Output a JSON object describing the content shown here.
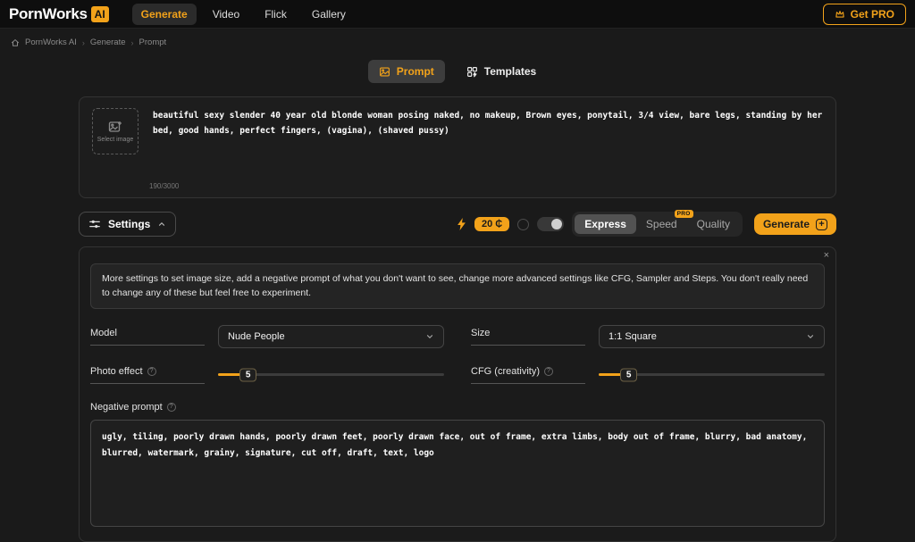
{
  "header": {
    "logo_text": "PornWorks",
    "logo_badge": "AI",
    "nav": [
      {
        "label": "Generate"
      },
      {
        "label": "Video"
      },
      {
        "label": "Flick"
      },
      {
        "label": "Gallery"
      }
    ],
    "get_pro_label": "Get PRO"
  },
  "breadcrumb": {
    "items": [
      {
        "label": "PornWorks AI"
      },
      {
        "label": "Generate"
      },
      {
        "label": "Prompt"
      }
    ]
  },
  "tabs": {
    "prompt_label": "Prompt",
    "templates_label": "Templates"
  },
  "prompt_area": {
    "select_image_label": "Select image",
    "prompt_text": "beautiful sexy slender 40 year old blonde woman posing naked, no makeup, Brown eyes, ponytail, 3/4 view, bare legs, standing by her bed, good hands, perfect fingers, (vagina), (shaved pussy)",
    "char_count": "190/3000"
  },
  "toolbar": {
    "settings_label": "Settings",
    "cost_label": "20 ₵",
    "modes": [
      {
        "label": "Express"
      },
      {
        "label": "Speed",
        "badge": "PRO"
      },
      {
        "label": "Quality"
      }
    ],
    "generate_label": "Generate"
  },
  "settings": {
    "close_label": "×",
    "info_text": "More settings to set image size, add a negative prompt of what you don't want to see, change more advanced settings like CFG, Sampler and Steps. You don't really need to change any of these but feel free to experiment.",
    "model": {
      "label": "Model",
      "value": "Nude People"
    },
    "size": {
      "label": "Size",
      "value": "1:1 Square"
    },
    "photo_effect": {
      "label": "Photo effect",
      "value": "5"
    },
    "cfg": {
      "label": "CFG (creativity)",
      "value": "5"
    },
    "negative_prompt": {
      "label": "Negative prompt",
      "value": "ugly, tiling, poorly drawn hands, poorly drawn feet, poorly drawn face, out of frame, extra limbs, body out of frame, blurry, bad anatomy, blurred, watermark, grainy, signature, cut off, draft, text, logo"
    }
  },
  "colors": {
    "accent": "#f2a21a"
  }
}
